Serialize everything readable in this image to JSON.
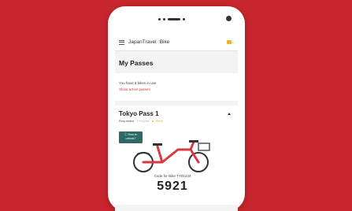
{
  "app": {
    "brand": "JapanTravel",
    "separator": "·",
    "product": "Bike",
    "flag_count": "1"
  },
  "page": {
    "title": "My Passes"
  },
  "summary": {
    "bikes_prefix": "You have ",
    "bikes_count": "1",
    "bikes_suffix": " bikes in use",
    "link": "Show active passes"
  },
  "pass": {
    "title": "Tokyo Pass 1",
    "status": "Requested",
    "id": "TY01234",
    "code": "5921",
    "unlock_label_1": "How to",
    "unlock_label_2": "unlock?",
    "bike_code_label": "Code for Bike TY01234",
    "pin": "5921"
  },
  "colors": {
    "background": "#c8262e",
    "link": "#d23a3a",
    "unlock_button": "#2e6a64",
    "bike_frame": "#d93a40"
  }
}
